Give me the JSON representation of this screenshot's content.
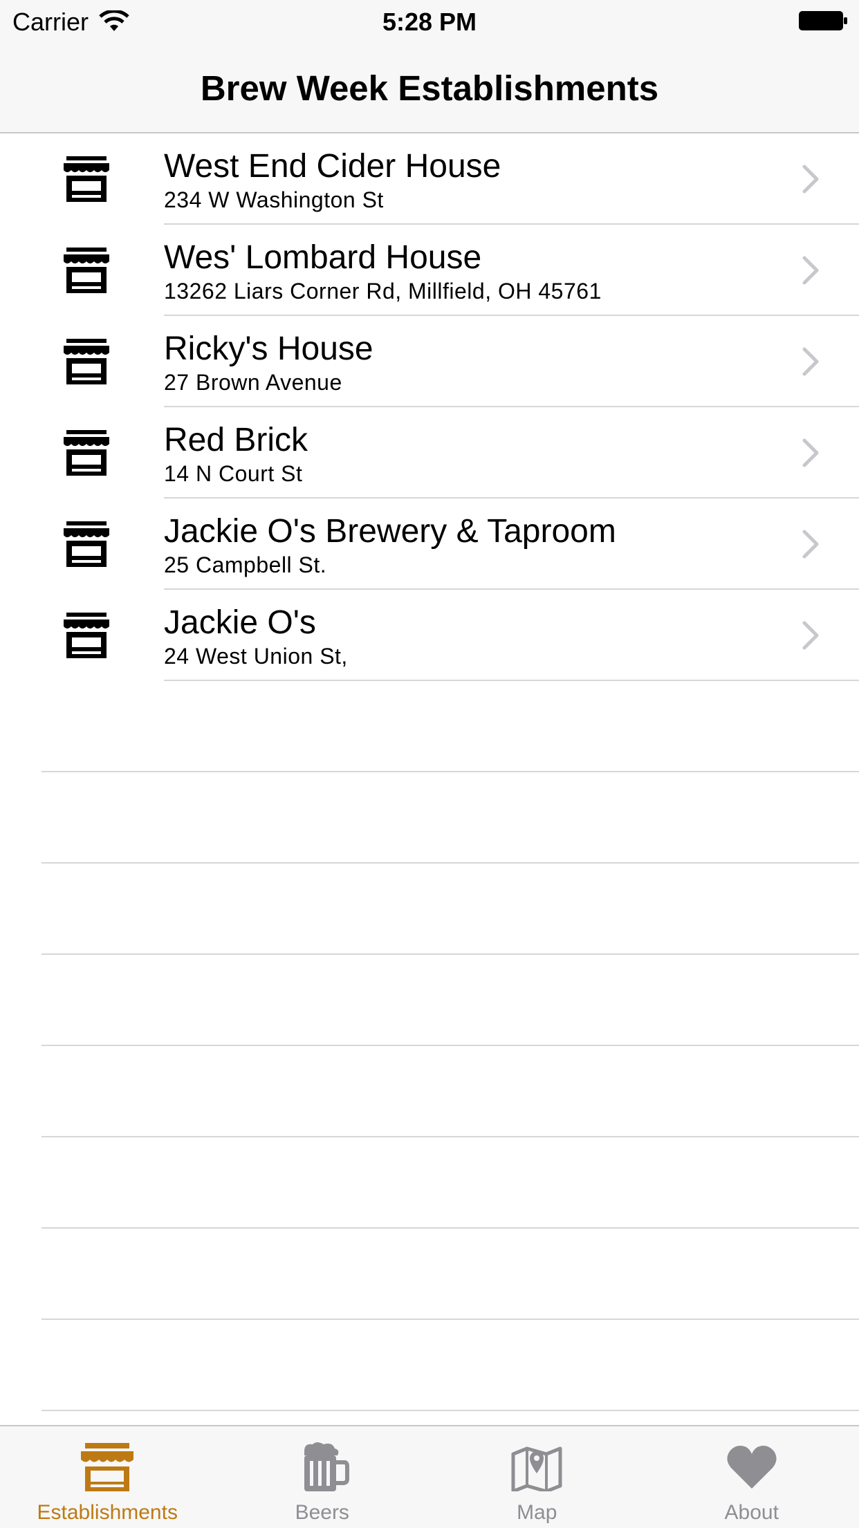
{
  "status_bar": {
    "carrier": "Carrier",
    "time": "5:28 PM"
  },
  "nav": {
    "title": "Brew Week Establishments"
  },
  "establishments": [
    {
      "name": "West End Cider House",
      "address": "234 W Washington St"
    },
    {
      "name": "Wes' Lombard House",
      "address": "13262 Liars Corner Rd, Millfield, OH 45761"
    },
    {
      "name": "Ricky's House",
      "address": "27 Brown Avenue"
    },
    {
      "name": "Red Brick",
      "address": "14 N Court St"
    },
    {
      "name": "Jackie O's Brewery & Taproom",
      "address": "25 Campbell St."
    },
    {
      "name": "Jackie O's",
      "address": "24 West Union St,"
    }
  ],
  "tabs": [
    {
      "label": "Establishments",
      "icon": "store-icon",
      "active": true
    },
    {
      "label": "Beers",
      "icon": "beer-mug-icon",
      "active": false
    },
    {
      "label": "Map",
      "icon": "map-icon",
      "active": false
    },
    {
      "label": "About",
      "icon": "heart-icon",
      "active": false
    }
  ],
  "colors": {
    "accent": "#bd7a14",
    "inactive": "#8e8e93",
    "chevron": "#c7c7cc",
    "bar_bg": "#f7f7f7"
  }
}
